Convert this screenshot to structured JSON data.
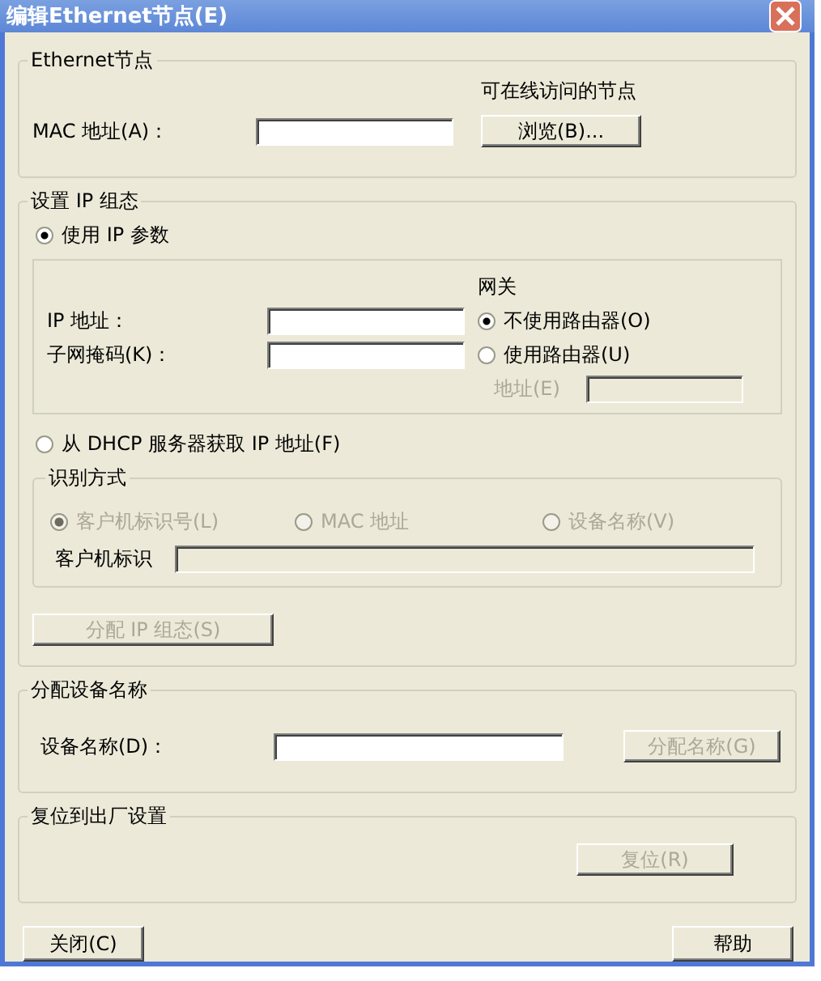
{
  "window": {
    "title": "编辑Ethernet节点(E)"
  },
  "ethernet_node": {
    "title": "Ethernet节点",
    "mac_label": "MAC 地址(A)：",
    "online_label": "可在线访问的节点",
    "browse_button": {
      "label": "浏览(B)...",
      "disabled": false
    }
  },
  "ip_config": {
    "title": "设置 IP 组态",
    "modes": [
      {
        "label": "使用 IP 参数",
        "selected": true
      },
      {
        "label": "从 DHCP 服务器获取 IP 地址(F)",
        "selected": false
      }
    ],
    "fields": [
      {
        "label": "IP 地址："
      },
      {
        "label": "子网掩码(K)："
      }
    ],
    "gateway": {
      "title": "网关",
      "options": [
        {
          "label": "不使用路由器(O)",
          "selected": true
        },
        {
          "label": "使用路由器(U)",
          "selected": false
        }
      ],
      "address": {
        "label": "地址(E)",
        "disabled": true
      }
    },
    "identification": {
      "title": "识别方式",
      "disabled": true,
      "options": [
        {
          "label": "客户机标识号(L)",
          "selected": true
        },
        {
          "label": "MAC 地址",
          "selected": false
        },
        {
          "label": "设备名称(V)",
          "selected": false
        }
      ],
      "client_id_label": "客户机标识"
    },
    "assign_button": {
      "label": "分配 IP 组态(S)",
      "disabled": true
    }
  },
  "device_name": {
    "title": "分配设备名称",
    "label": "设备名称(D)：",
    "button": {
      "label": "分配名称(G)",
      "disabled": true
    }
  },
  "factory_reset": {
    "title": "复位到出厂设置",
    "button": {
      "label": "复位(R)",
      "disabled": true
    }
  },
  "footer": [
    {
      "label": "关闭(C)"
    },
    {
      "label": "帮助"
    }
  ]
}
